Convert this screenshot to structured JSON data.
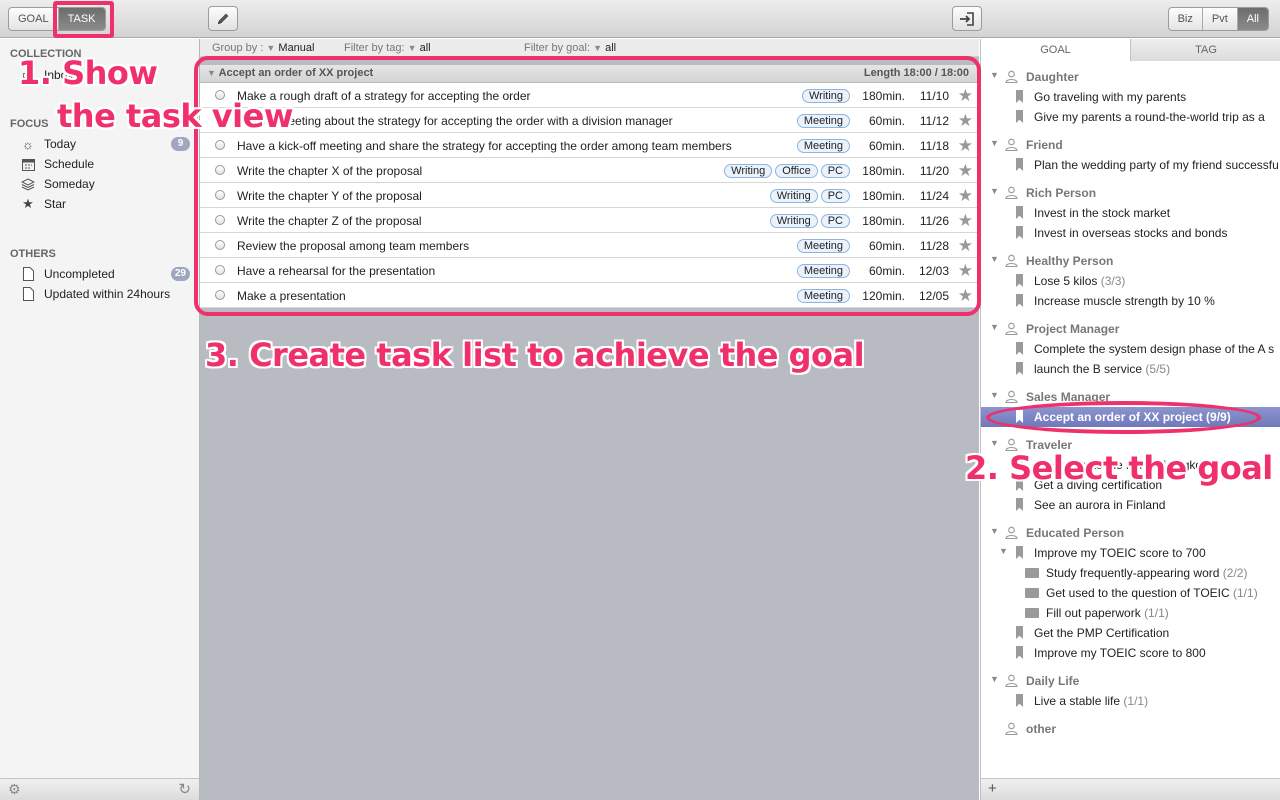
{
  "toolbar": {
    "mode_goal": "GOAL",
    "mode_task": "TASK",
    "filter_biz": "Biz",
    "filter_pvt": "Pvt",
    "filter_all": "All"
  },
  "sidebar": {
    "collection_header": "COLLECTION",
    "inbox_label": "Inbox",
    "focus_header": "FOCUS",
    "focus_items": [
      {
        "label": "Today",
        "badge": "9",
        "icon": "sun-icon"
      },
      {
        "label": "Schedule",
        "icon": "calendar-icon"
      },
      {
        "label": "Someday",
        "icon": "layers-icon"
      },
      {
        "label": "Star",
        "icon": "star-icon"
      }
    ],
    "others_header": "OTHERS",
    "others_items": [
      {
        "label": "Uncompleted",
        "badge": "29",
        "icon": "document-icon"
      },
      {
        "label": "Updated within 24hours",
        "icon": "document-icon"
      }
    ]
  },
  "filterbar": {
    "group_by_label": "Group by :",
    "group_by_value": "Manual",
    "tag_label": "Filter by tag:",
    "tag_value": "all",
    "goal_label": "Filter by goal:",
    "goal_value": "all"
  },
  "group": {
    "title": "Accept an order of XX project",
    "length": "Length 18:00 / 18:00"
  },
  "tasks": [
    {
      "title": "Make a rough draft of a strategy for accepting the order",
      "tags": [
        "Writing"
      ],
      "duration": "180min.",
      "date": "11/10"
    },
    {
      "title": "Have a meeting about the strategy for accepting the order with a division manager",
      "tags": [
        "Meeting"
      ],
      "duration": "60min.",
      "date": "11/12"
    },
    {
      "title": "Have a kick-off meeting and share the strategy for accepting the order among team members",
      "tags": [
        "Meeting"
      ],
      "duration": "60min.",
      "date": "11/18"
    },
    {
      "title": "Write the chapter X of the proposal",
      "tags": [
        "Writing",
        "Office",
        "PC"
      ],
      "duration": "180min.",
      "date": "11/20"
    },
    {
      "title": "Write the chapter Y of the proposal",
      "tags": [
        "Writing",
        "PC"
      ],
      "duration": "180min.",
      "date": "11/24"
    },
    {
      "title": "Write the chapter Z of the proposal",
      "tags": [
        "Writing",
        "PC"
      ],
      "duration": "180min.",
      "date": "11/26"
    },
    {
      "title": "Review the proposal among team members",
      "tags": [
        "Meeting"
      ],
      "duration": "60min.",
      "date": "11/28"
    },
    {
      "title": "Have a rehearsal for the presentation",
      "tags": [
        "Meeting"
      ],
      "duration": "60min.",
      "date": "12/03"
    },
    {
      "title": "Make a presentation",
      "tags": [
        "Meeting"
      ],
      "duration": "120min.",
      "date": "12/05"
    }
  ],
  "goal_panel": {
    "tab_goal": "GOAL",
    "tab_tag": "TAG",
    "rows": [
      {
        "kind": "cat",
        "label": "Daughter"
      },
      {
        "kind": "goal",
        "label": "Go traveling with my parents"
      },
      {
        "kind": "goal",
        "label": "Give my parents a round-the-world trip as a"
      },
      {
        "kind": "cat",
        "label": "Friend"
      },
      {
        "kind": "goal",
        "label": "Plan the wedding party of my friend successfu"
      },
      {
        "kind": "cat",
        "label": "Rich Person"
      },
      {
        "kind": "goal",
        "label": "Invest in the stock market"
      },
      {
        "kind": "goal",
        "label": "Invest in overseas stocks and bonds"
      },
      {
        "kind": "cat",
        "label": "Healthy Person"
      },
      {
        "kind": "goal",
        "label": "Lose 5 kilos",
        "count": "(3/3)"
      },
      {
        "kind": "goal",
        "label": "Increase muscle strength by 10 %"
      },
      {
        "kind": "cat",
        "label": "Project Manager"
      },
      {
        "kind": "goal",
        "label": "Complete the system design phase of the A s"
      },
      {
        "kind": "goal",
        "label": "launch the B service",
        "count": "(5/5)"
      },
      {
        "kind": "cat",
        "label": "Sales Manager"
      },
      {
        "kind": "goal",
        "label": "Accept an order of XX project (9/9)",
        "selected": true
      },
      {
        "kind": "cat",
        "label": "Traveler"
      },
      {
        "kind": "goal",
        "label": "Take a trip to the ruins of Angkor in J"
      },
      {
        "kind": "goal",
        "label": "Get a diving certification"
      },
      {
        "kind": "goal",
        "label": "See an aurora in Finland"
      },
      {
        "kind": "cat",
        "label": "Educated Person"
      },
      {
        "kind": "goal",
        "label": "Improve my TOEIC score to 700",
        "expanded": true
      },
      {
        "kind": "sub",
        "label": "Study frequently-appearing word",
        "count": "(2/2)"
      },
      {
        "kind": "sub",
        "label": "Get used to the question of TOEIC",
        "count": "(1/1)"
      },
      {
        "kind": "sub",
        "label": "Fill out paperwork",
        "count": "(1/1)"
      },
      {
        "kind": "goal",
        "label": "Get the PMP Certification"
      },
      {
        "kind": "goal",
        "label": "Improve my TOEIC score to 800"
      },
      {
        "kind": "cat",
        "label": "Daily Life"
      },
      {
        "kind": "goal",
        "label": "Live a stable life",
        "count": "(1/1)"
      },
      {
        "kind": "cat",
        "label": "other",
        "no_disclosure": true
      }
    ],
    "add_label": "+"
  },
  "annotations": {
    "step1_line1": "1. Show",
    "step1_line2": "the task view",
    "step2": "2. Select the goal",
    "step3": "3. Create task list to achieve the goal"
  },
  "colors": {
    "annotation": "#f0306a",
    "selection": "#7b84c5",
    "tag_border": "#8fb4db"
  }
}
